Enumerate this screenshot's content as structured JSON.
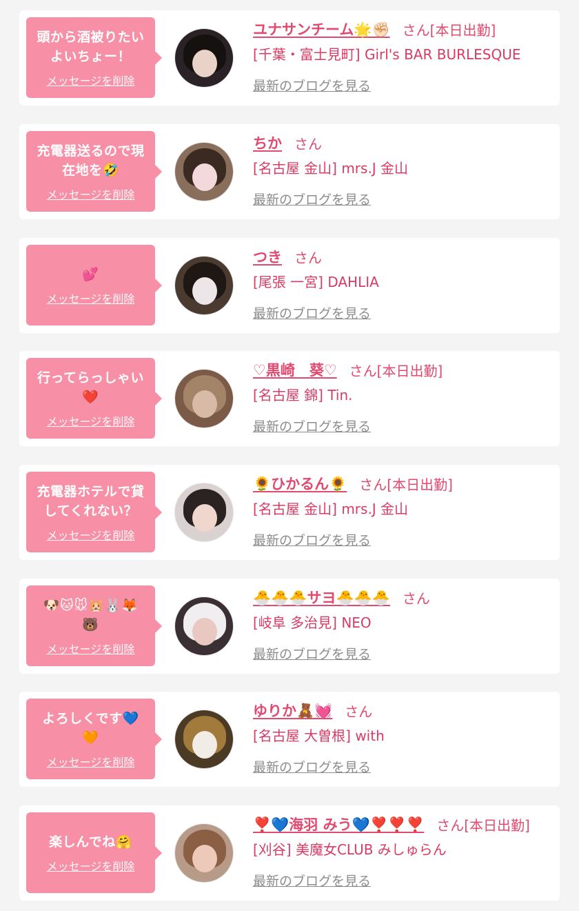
{
  "blog_link_label": "最新のブログを見る",
  "delete_label": "メッセージを削除",
  "colors": {
    "bubble": "#f78fa6",
    "name": "#e2496e",
    "link_gray": "#8c8c8c",
    "background": "#f4f4f4"
  },
  "entries": [
    {
      "message": "頭から酒被りたい\nよいちょー！",
      "name": "ユナサンチーム🌟✊🏻",
      "suffix": "さん[本日出勤]",
      "shop": "[千葉・富士見町] Girl's BAR BURLESQUE"
    },
    {
      "message": "充電器送るので現\n在地を🤣",
      "name": "ちか",
      "suffix": "さん",
      "shop": "[名古屋 金山] mrs.J 金山"
    },
    {
      "message": "💕",
      "name": "つき",
      "suffix": "さん",
      "shop": "[尾張 一宮] DAHLIA"
    },
    {
      "message": "行ってらっしゃい\n❤️",
      "name": "♡黒崎　葵♡",
      "suffix": "さん[本日出勤]",
      "shop": "[名古屋 錦] Tin."
    },
    {
      "message": "充電器ホテルで貸\nしてくれない？",
      "name": "🌻ひかるん🌻",
      "suffix": "さん[本日出勤]",
      "shop": "[名古屋 金山] mrs.J 金山"
    },
    {
      "message": "🐶🐱🐭🐹🐰🦊\n🐻",
      "name": "🐣🐣🐣サヨ🐣🐣🐣",
      "suffix": "さん",
      "shop": "[岐阜 多治見] NEO"
    },
    {
      "message": "よろしくです💙\n🧡",
      "name": "ゆりか🧸💓",
      "suffix": "さん",
      "shop": "[名古屋 大曽根] with"
    },
    {
      "message": "楽しんでね🤗",
      "name": "❣️💙海羽 みう💙❣️❣️❣️",
      "suffix": "さん[本日出勤]",
      "shop": "[刈谷] 美魔女CLUB みしゅらん"
    }
  ]
}
